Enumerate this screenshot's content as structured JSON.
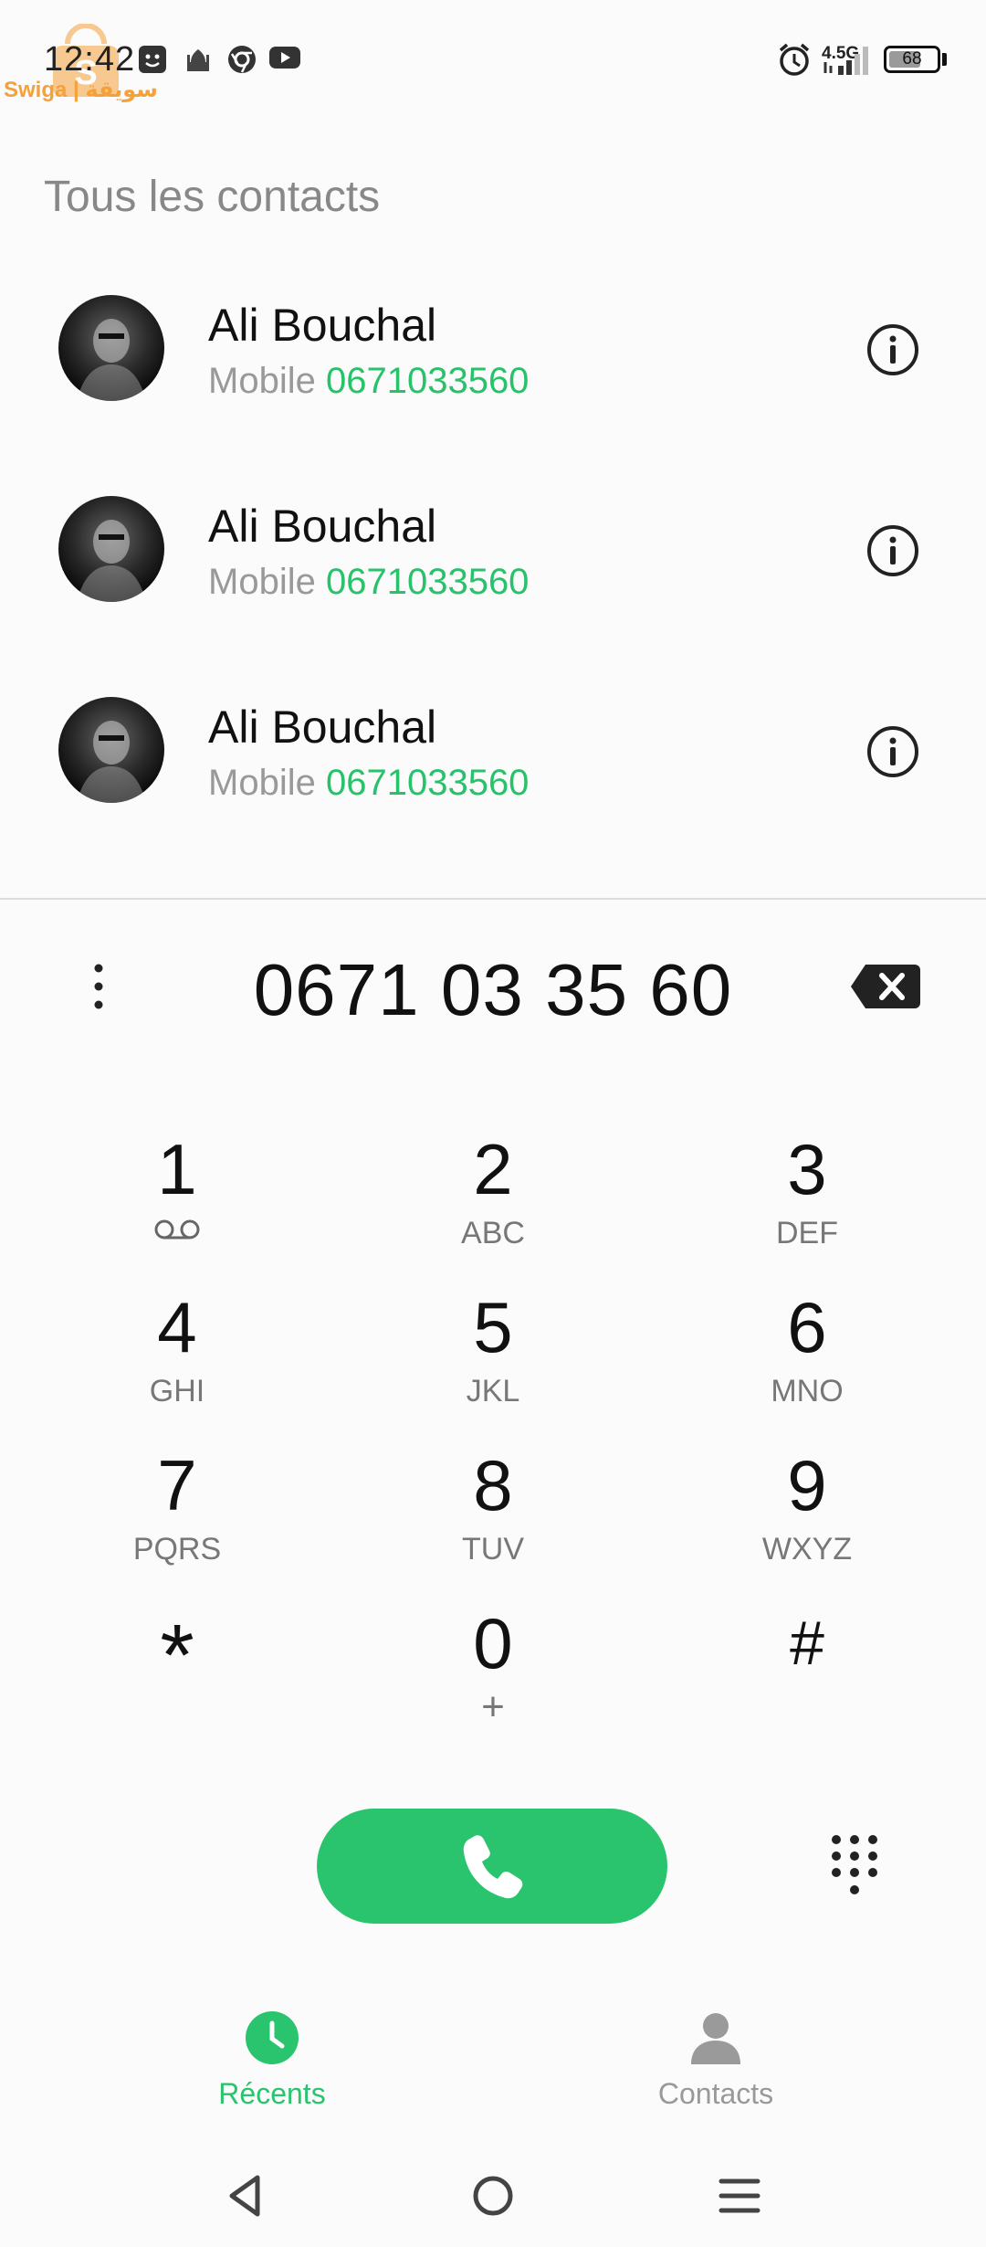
{
  "status_bar": {
    "time": "12:42",
    "network": "4.5G",
    "battery_level": "68",
    "battery_percent": 68,
    "icons": [
      "smiley-notification-icon",
      "mosque-icon",
      "browser-icon",
      "youtube-icon",
      "alarm-icon",
      "signal-icon"
    ]
  },
  "watermark": {
    "text": "Swiga | سويقة"
  },
  "contacts": {
    "title": "Tous les contacts",
    "items": [
      {
        "name": "Ali Bouchal",
        "type": "Mobile",
        "number": "0671033560"
      },
      {
        "name": "Ali Bouchal",
        "type": "Mobile",
        "number": "0671033560"
      },
      {
        "name": "Ali Bouchal",
        "type": "Mobile",
        "number": "0671033560"
      }
    ]
  },
  "dialer": {
    "number": "0671 03 35 60",
    "keys": [
      {
        "digit": "1",
        "letters": ""
      },
      {
        "digit": "2",
        "letters": "ABC"
      },
      {
        "digit": "3",
        "letters": "DEF"
      },
      {
        "digit": "4",
        "letters": "GHI"
      },
      {
        "digit": "5",
        "letters": "JKL"
      },
      {
        "digit": "6",
        "letters": "MNO"
      },
      {
        "digit": "7",
        "letters": "PQRS"
      },
      {
        "digit": "8",
        "letters": "TUV"
      },
      {
        "digit": "9",
        "letters": "WXYZ"
      },
      {
        "digit": "*",
        "letters": ""
      },
      {
        "digit": "0",
        "letters": "+"
      },
      {
        "digit": "#",
        "letters": ""
      }
    ]
  },
  "bottom_nav": {
    "tabs": [
      {
        "label": "Récents",
        "icon": "clock-icon",
        "active": true
      },
      {
        "label": "Contacts",
        "icon": "person-icon",
        "active": false
      }
    ]
  },
  "colors": {
    "accent": "#29c46d",
    "number_green": "#27c26a",
    "muted_text": "#999999",
    "inactive_icon": "#9a9a9a"
  }
}
